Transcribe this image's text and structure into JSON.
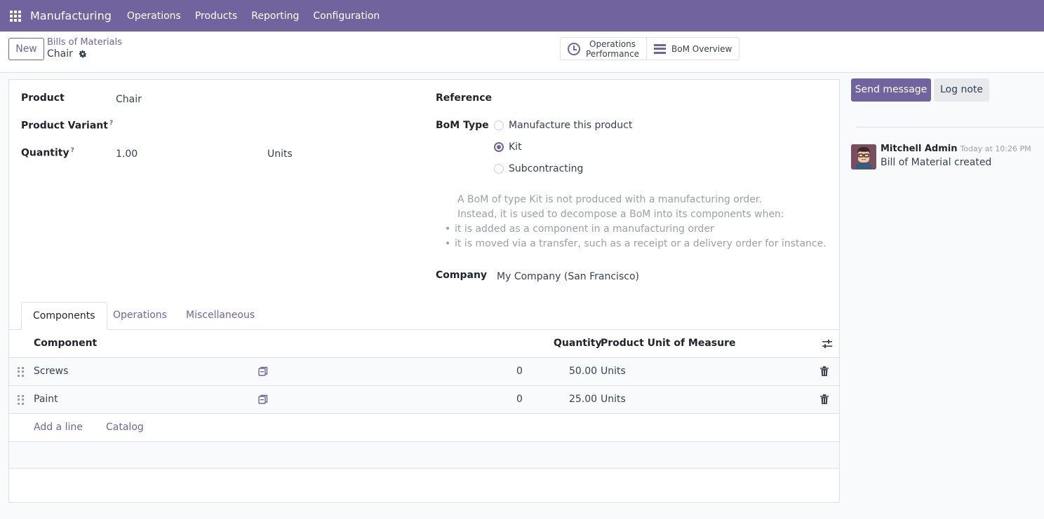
{
  "navbar": {
    "brand": "Manufacturing",
    "menu": [
      "Operations",
      "Products",
      "Reporting",
      "Configuration"
    ]
  },
  "control": {
    "new_label": "New",
    "breadcrumb": "Bills of Materials",
    "record_name": "Chair",
    "smart_buttons": {
      "ops_line1": "Operations",
      "ops_line2": "Performance",
      "bom_overview": "BoM Overview"
    }
  },
  "form": {
    "product_label": "Product",
    "product_value": "Chair",
    "variant_label": "Product Variant",
    "quantity_label": "Quantity",
    "quantity_value": "1.00",
    "quantity_uom": "Units",
    "help_mark": "?",
    "reference_label": "Reference",
    "bom_type_label": "BoM Type",
    "bom_type_options": [
      "Manufacture this product",
      "Kit",
      "Subcontracting"
    ],
    "bom_type_selected": "Kit",
    "help_line1": "A BoM of type Kit is not produced with a manufacturing order.",
    "help_line2": "Instead, it is used to decompose a BoM into its components when:",
    "help_bullets": [
      "it is added as a component in a manufacturing order",
      "it is moved via a transfer, such as a receipt or a delivery order for instance."
    ],
    "company_label": "Company",
    "company_value": "My Company (San Francisco)"
  },
  "tabs": [
    "Components",
    "Operations",
    "Miscellaneous"
  ],
  "table": {
    "headers": {
      "component": "Component",
      "quantity": "Quantity",
      "uom": "Product Unit of Measure"
    },
    "rows": [
      {
        "component": "Screws",
        "on_hand": "0",
        "quantity": "50.00",
        "uom": "Units"
      },
      {
        "component": "Paint",
        "on_hand": "0",
        "quantity": "25.00",
        "uom": "Units"
      }
    ],
    "add_line": "Add a line",
    "catalog": "Catalog"
  },
  "chatter": {
    "send_message": "Send message",
    "log_note": "Log note",
    "messages": [
      {
        "author": "Mitchell Admin",
        "date": "Today at 10:26 PM",
        "body": "Bill of Material created"
      }
    ]
  },
  "colors": {
    "brand": "#71639e",
    "border": "#dee2e6"
  }
}
